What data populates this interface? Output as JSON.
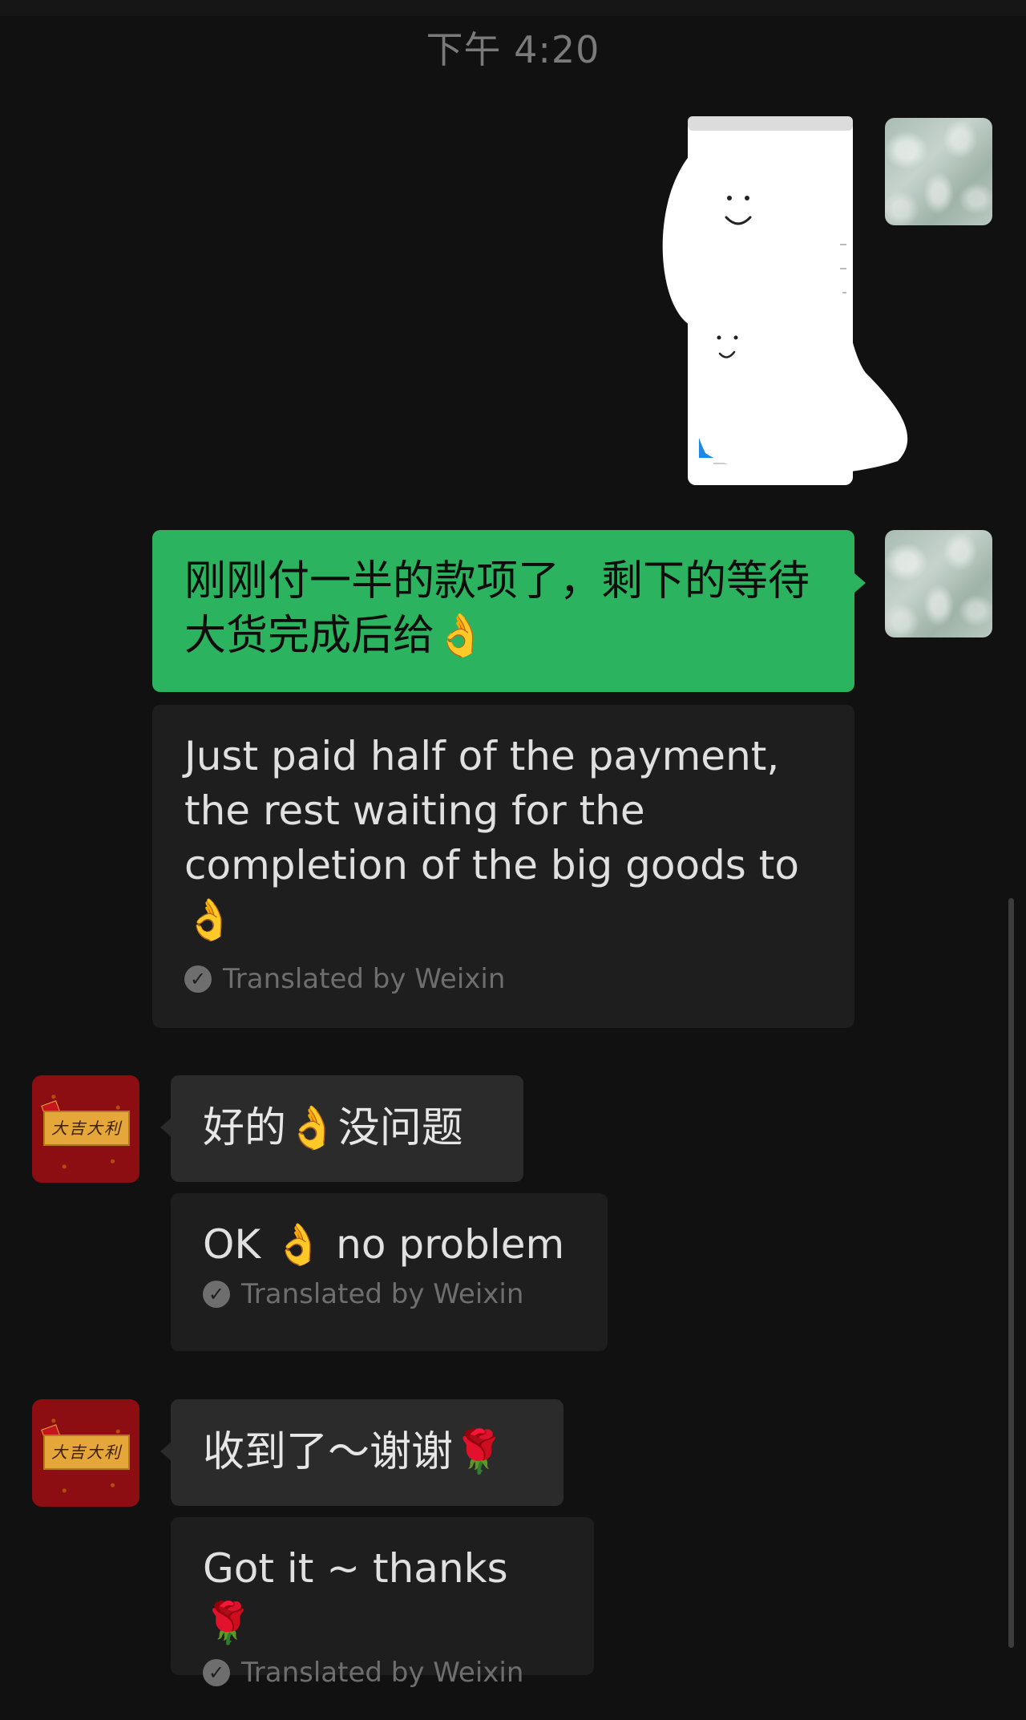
{
  "timestamp": "下午 4:20",
  "messages": [
    {
      "sender": "me",
      "type": "image",
      "image_description_icon": "screenshot-image"
    },
    {
      "sender": "me",
      "type": "text",
      "text": "刚刚付一半的款项了，剩下的等待大货完成后给👌",
      "translation": "Just paid half of the payment, the rest waiting for the completion of the big goods to 👌",
      "translated_by": "Translated by Weixin"
    },
    {
      "sender": "contact",
      "type": "text",
      "text": "好的👌没问题",
      "translation": "OK 👌 no problem",
      "translated_by": "Translated by Weixin"
    },
    {
      "sender": "contact",
      "type": "text",
      "text": "收到了～谢谢🌹",
      "translation": "Got it ~ thanks 🌹",
      "translated_by": "Translated by Weixin"
    }
  ],
  "contact_avatar_text": "大吉大利",
  "colors": {
    "background": "#111111",
    "sent_bubble": "#2bb35f",
    "received_bubble": "#2b2b2b",
    "translation_bubble": "#1e1e1e"
  }
}
